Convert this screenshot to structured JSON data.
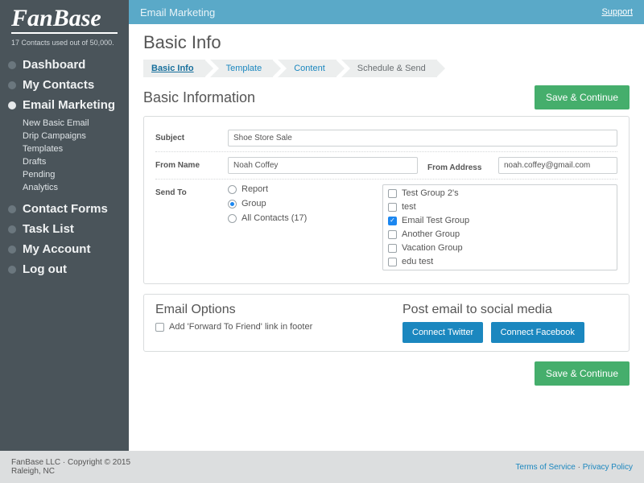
{
  "brand": "FanBase",
  "usage_text": "17 Contacts used out of 50,000.",
  "nav": [
    {
      "label": "Dashboard"
    },
    {
      "label": "My Contacts"
    },
    {
      "label": "Email Marketing",
      "active": true
    },
    {
      "label": "Contact Forms"
    },
    {
      "label": "Task List"
    },
    {
      "label": "My Account"
    },
    {
      "label": "Log out"
    }
  ],
  "subnav": [
    "New Basic Email",
    "Drip Campaigns",
    "Templates",
    "Drafts",
    "Pending",
    "Analytics"
  ],
  "topbar": {
    "title": "Email Marketing",
    "support": "Support"
  },
  "page_title": "Basic Info",
  "crumbs": [
    "Basic Info",
    "Template",
    "Content",
    "Schedule & Send"
  ],
  "section_title": "Basic Information",
  "save_label": "Save & Continue",
  "labels": {
    "subject": "Subject",
    "from_name": "From Name",
    "from_address": "From Address",
    "send_to": "Send To"
  },
  "values": {
    "subject": "Shoe Store Sale",
    "from_name": "Noah Coffey",
    "from_address": "noah.coffey@gmail.com"
  },
  "send_to_options": [
    "Report",
    "Group",
    "All Contacts (17)"
  ],
  "send_to_selected": "Group",
  "groups": [
    {
      "label": "Test Group 2's",
      "checked": false
    },
    {
      "label": "test",
      "checked": false
    },
    {
      "label": "Email Test Group",
      "checked": true
    },
    {
      "label": "Another Group",
      "checked": false
    },
    {
      "label": "Vacation Group",
      "checked": false
    },
    {
      "label": "edu test",
      "checked": false
    }
  ],
  "email_options": {
    "heading": "Email Options",
    "forward_label": "Add 'Forward To Friend' link in footer"
  },
  "social": {
    "heading": "Post email to social media",
    "twitter": "Connect Twitter",
    "facebook": "Connect Facebook"
  },
  "footer": {
    "left1": "FanBase LLC · Copyright © 2015",
    "left2": "Raleigh, NC",
    "tos": "Terms of Service",
    "privacy": "Privacy Policy",
    "sep": " · "
  }
}
